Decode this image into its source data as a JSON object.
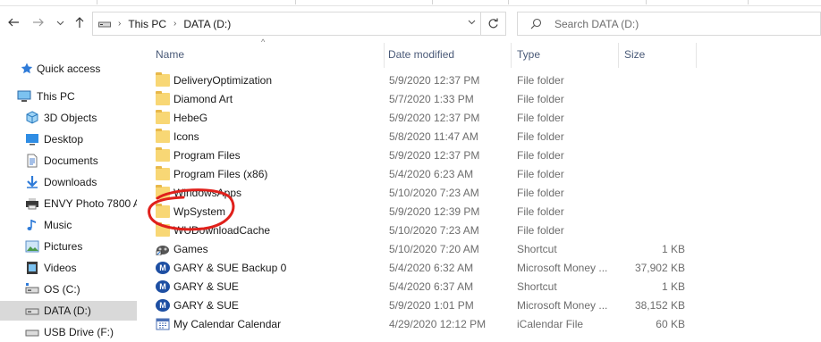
{
  "nav": {
    "address": [
      "This PC",
      "DATA (D:)"
    ],
    "search_placeholder": "Search DATA (D:)"
  },
  "sidebar": {
    "items": [
      {
        "label": "Quick access",
        "icon": "star-icon"
      },
      {
        "label": "This PC",
        "icon": "pc-icon"
      },
      {
        "label": "3D Objects",
        "icon": "cube-icon"
      },
      {
        "label": "Desktop",
        "icon": "desktop-icon"
      },
      {
        "label": "Documents",
        "icon": "document-icon"
      },
      {
        "label": "Downloads",
        "icon": "download-icon"
      },
      {
        "label": "ENVY Photo 7800 A",
        "icon": "printer-icon"
      },
      {
        "label": "Music",
        "icon": "music-icon"
      },
      {
        "label": "Pictures",
        "icon": "picture-icon"
      },
      {
        "label": "Videos",
        "icon": "video-icon"
      },
      {
        "label": "OS (C:)",
        "icon": "drive-icon"
      },
      {
        "label": "DATA (D:)",
        "icon": "drive-icon"
      },
      {
        "label": "USB Drive (F:)",
        "icon": "usb-drive-icon"
      }
    ]
  },
  "columns": {
    "name": "Name",
    "date": "Date modified",
    "type": "Type",
    "size": "Size"
  },
  "files": [
    {
      "name": "DeliveryOptimization",
      "date": "5/9/2020 12:37 PM",
      "type": "File folder",
      "size": "",
      "icon": "folder-icon"
    },
    {
      "name": "Diamond Art",
      "date": "5/7/2020 1:33 PM",
      "type": "File folder",
      "size": "",
      "icon": "folder-icon"
    },
    {
      "name": "HebeG",
      "date": "5/9/2020 12:37 PM",
      "type": "File folder",
      "size": "",
      "icon": "folder-icon"
    },
    {
      "name": "Icons",
      "date": "5/8/2020 11:47 AM",
      "type": "File folder",
      "size": "",
      "icon": "folder-icon"
    },
    {
      "name": "Program Files",
      "date": "5/9/2020 12:37 PM",
      "type": "File folder",
      "size": "",
      "icon": "folder-icon"
    },
    {
      "name": "Program Files (x86)",
      "date": "5/4/2020 6:23 AM",
      "type": "File folder",
      "size": "",
      "icon": "folder-icon"
    },
    {
      "name": "WindowsApps",
      "date": "5/10/2020 7:23 AM",
      "type": "File folder",
      "size": "",
      "icon": "folder-icon"
    },
    {
      "name": "WpSystem",
      "date": "5/9/2020 12:39 PM",
      "type": "File folder",
      "size": "",
      "icon": "folder-icon"
    },
    {
      "name": "WUDownloadCache",
      "date": "5/10/2020 7:23 AM",
      "type": "File folder",
      "size": "",
      "icon": "folder-icon"
    },
    {
      "name": "Games",
      "date": "5/10/2020 7:20 AM",
      "type": "Shortcut",
      "size": "1 KB",
      "icon": "games-shortcut-icon"
    },
    {
      "name": "GARY & SUE Backup 0",
      "date": "5/4/2020 6:32 AM",
      "type": "Microsoft Money ...",
      "size": "37,902 KB",
      "icon": "money-icon"
    },
    {
      "name": "GARY & SUE",
      "date": "5/4/2020 6:37 AM",
      "type": "Shortcut",
      "size": "1 KB",
      "icon": "money-icon"
    },
    {
      "name": "GARY & SUE",
      "date": "5/9/2020 1:01 PM",
      "type": "Microsoft Money ...",
      "size": "38,152 KB",
      "icon": "money-icon"
    },
    {
      "name": "My Calendar Calendar",
      "date": "4/29/2020 12:12 PM",
      "type": "iCalendar File",
      "size": "60 KB",
      "icon": "calendar-icon"
    }
  ],
  "colors": {
    "folder": "#f8d775",
    "selection": "#d9d9d9",
    "annotation": "#e0201b",
    "header_text": "#4a5a78"
  }
}
